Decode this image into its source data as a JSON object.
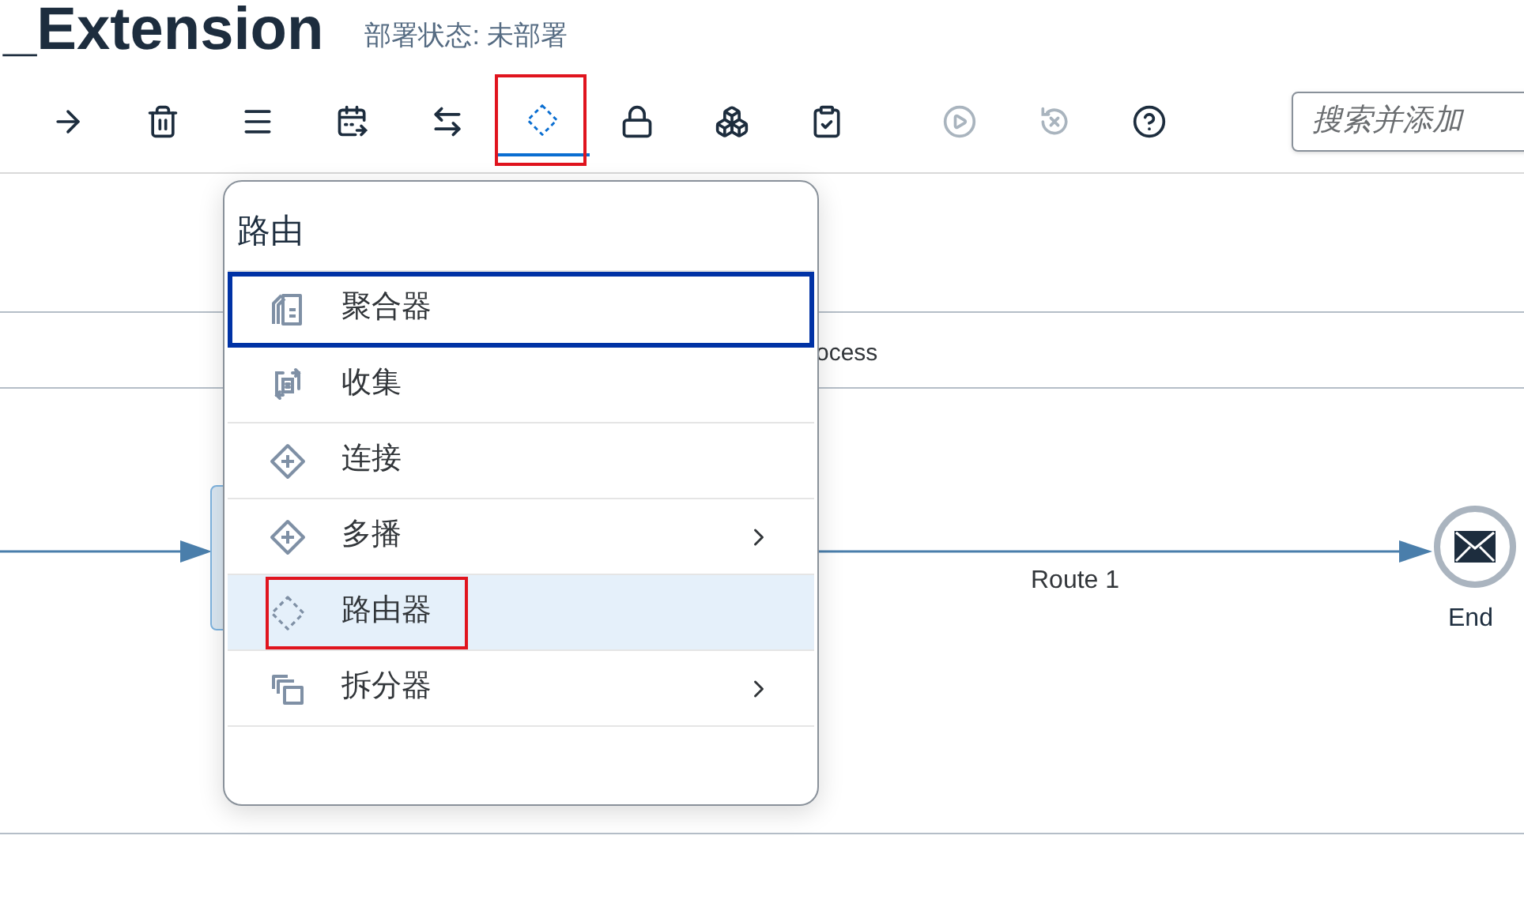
{
  "header": {
    "title": "_Extension",
    "status": "部署状态: 未部署"
  },
  "toolbar": {
    "buttons": [
      {
        "kind": "arrow",
        "selected": false,
        "disabled": false,
        "annotated": false
      },
      {
        "kind": "trash",
        "selected": false,
        "disabled": false,
        "annotated": false
      },
      {
        "kind": "lines",
        "selected": false,
        "disabled": false,
        "annotated": false
      },
      {
        "kind": "calendar",
        "selected": false,
        "disabled": false,
        "annotated": false
      },
      {
        "kind": "swap",
        "selected": false,
        "disabled": false,
        "annotated": false
      },
      {
        "kind": "router",
        "selected": true,
        "disabled": false,
        "annotated": true
      },
      {
        "kind": "lock",
        "selected": false,
        "disabled": false,
        "annotated": false
      },
      {
        "kind": "cubes",
        "selected": false,
        "disabled": false,
        "annotated": false
      },
      {
        "kind": "clipboard",
        "selected": false,
        "disabled": false,
        "annotated": false
      },
      {
        "kind": "separator"
      },
      {
        "kind": "play",
        "selected": false,
        "disabled": true,
        "annotated": false
      },
      {
        "kind": "undo",
        "selected": false,
        "disabled": true,
        "annotated": false
      },
      {
        "kind": "help",
        "selected": false,
        "disabled": false,
        "annotated": false
      },
      {
        "kind": "separator"
      }
    ],
    "search": {
      "placeholder": "搜索并添加"
    }
  },
  "menu": {
    "title": "路由",
    "items": [
      {
        "label": "聚合器",
        "kind": "aggregator",
        "focused": true,
        "selected": false,
        "submenu": false,
        "annotated": false
      },
      {
        "label": "收集",
        "kind": "gather",
        "focused": false,
        "selected": false,
        "submenu": false,
        "annotated": false
      },
      {
        "label": "连接",
        "kind": "join",
        "focused": false,
        "selected": false,
        "submenu": false,
        "annotated": false
      },
      {
        "label": "多播",
        "kind": "multicast",
        "focused": false,
        "selected": false,
        "submenu": true,
        "annotated": false
      },
      {
        "label": "路由器",
        "kind": "router",
        "focused": false,
        "selected": true,
        "submenu": false,
        "annotated": true
      },
      {
        "label": "拆分器",
        "kind": "splitter",
        "focused": false,
        "selected": false,
        "submenu": true,
        "annotated": false
      }
    ]
  },
  "diagram": {
    "lane_label": "ocess",
    "route_label": "Route 1",
    "end_label": "End"
  }
}
